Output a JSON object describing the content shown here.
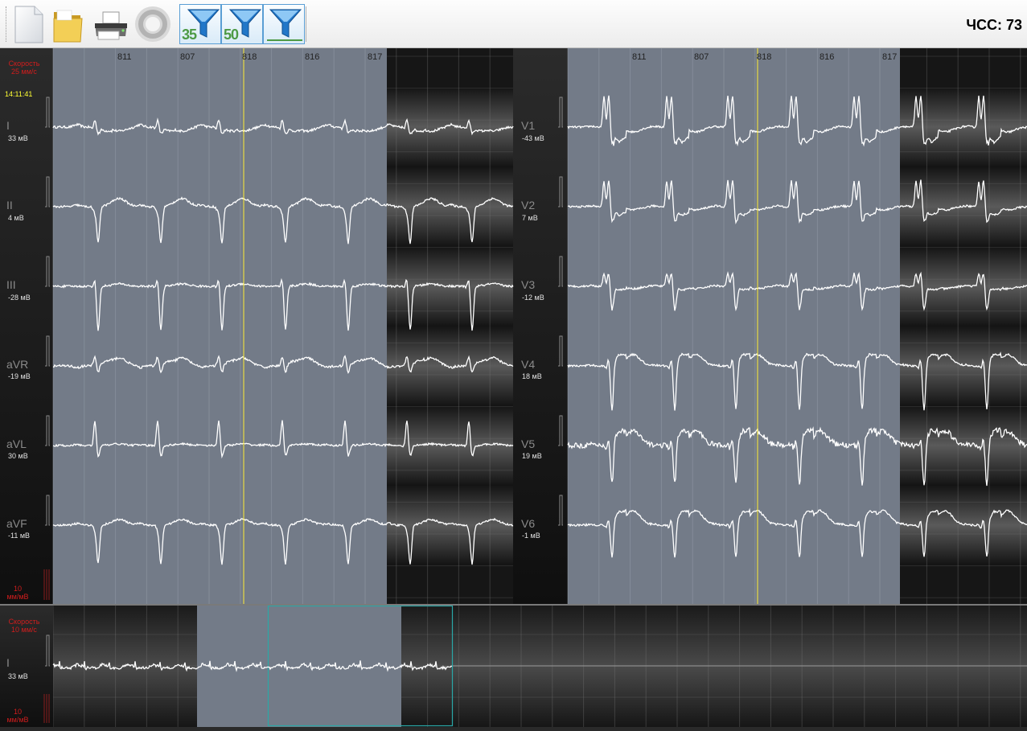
{
  "toolbar": {
    "buttons": [
      {
        "name": "new-document-icon"
      },
      {
        "name": "folder-icon"
      },
      {
        "name": "printer-icon"
      },
      {
        "name": "record-icon"
      },
      {
        "name": "filter-35-icon",
        "label": "35"
      },
      {
        "name": "filter-50-icon",
        "label": "50"
      },
      {
        "name": "filter-baseline-icon"
      }
    ],
    "heart_rate_label": "ЧСС: 73"
  },
  "colors": {
    "selection": "#737b88",
    "trace": "#ffffff",
    "cursor": "#ffee33",
    "red_text": "#d21d1d",
    "time_text": "#ffff33",
    "filter_number": "#4d9a45"
  },
  "ecg": {
    "speed_label": "Скорость\n25 мм/с",
    "time_label": "14:11:41",
    "gain_label": "10\nмм/мВ",
    "rr_intervals": [
      "811",
      "807",
      "818",
      "816",
      "817"
    ],
    "limb_leads": [
      {
        "name": "I",
        "value": "33 мВ"
      },
      {
        "name": "II",
        "value": "4 мВ"
      },
      {
        "name": "III",
        "value": "-28 мВ"
      },
      {
        "name": "aVR",
        "value": "-19 мВ"
      },
      {
        "name": "aVL",
        "value": "30 мВ"
      },
      {
        "name": "aVF",
        "value": "-11 мВ"
      }
    ],
    "chest_leads": [
      {
        "name": "V1",
        "value": "-43 мВ"
      },
      {
        "name": "V2",
        "value": "7 мВ"
      },
      {
        "name": "V3",
        "value": "-12 мВ"
      },
      {
        "name": "V4",
        "value": "18 мВ"
      },
      {
        "name": "V5",
        "value": "19 мВ"
      },
      {
        "name": "V6",
        "value": "-1 мВ"
      }
    ]
  },
  "rhythm": {
    "speed_label": "Скорость\n10 мм/с",
    "lead": "I",
    "value": "33 мВ",
    "gain_label": "10\nмм/мВ"
  }
}
